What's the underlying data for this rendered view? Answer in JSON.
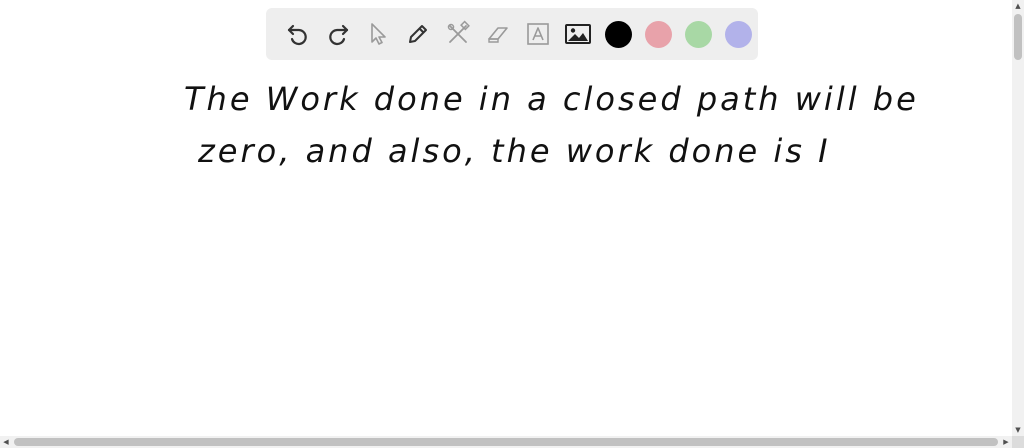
{
  "toolbar": {
    "tools": [
      {
        "name": "undo-icon",
        "enabled": true
      },
      {
        "name": "redo-icon",
        "enabled": true
      },
      {
        "name": "pointer-icon",
        "enabled": false
      },
      {
        "name": "pencil-icon",
        "enabled": true
      },
      {
        "name": "tools-icon",
        "enabled": false
      },
      {
        "name": "eraser-icon",
        "enabled": false
      },
      {
        "name": "text-icon",
        "enabled": false
      },
      {
        "name": "image-icon",
        "enabled": true
      }
    ],
    "colors": [
      "#000000",
      "#e8a2aa",
      "#a8d8a5",
      "#b2b2ea"
    ]
  },
  "note": {
    "line1": "The Work done in a closed path will be",
    "line2": "zero, and also, the work done is I"
  }
}
